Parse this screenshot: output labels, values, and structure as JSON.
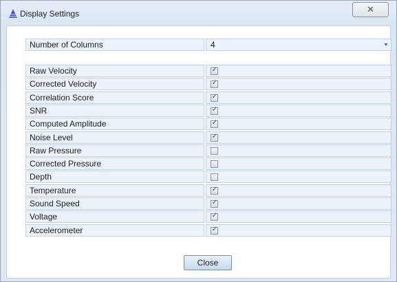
{
  "window": {
    "title": "Display Settings",
    "close_glyph": "✕"
  },
  "number_of_columns": {
    "label": "Number of Columns",
    "value": "4"
  },
  "options": [
    {
      "label": "Raw Velocity",
      "checked": true
    },
    {
      "label": "Corrected Velocity",
      "checked": true
    },
    {
      "label": "Correlation Score",
      "checked": true
    },
    {
      "label": "SNR",
      "checked": true
    },
    {
      "label": "Computed Amplitude",
      "checked": true
    },
    {
      "label": "Noise Level",
      "checked": true
    },
    {
      "label": "Raw Pressure",
      "checked": false
    },
    {
      "label": "Corrected Pressure",
      "checked": false
    },
    {
      "label": "Depth",
      "checked": false
    },
    {
      "label": "Temperature",
      "checked": true
    },
    {
      "label": "Sound Speed",
      "checked": true
    },
    {
      "label": "Voltage",
      "checked": true
    },
    {
      "label": "Accelerometer",
      "checked": true
    }
  ],
  "close_button": {
    "label": "Close"
  },
  "icons": {
    "app": "app-triangle-icon",
    "close": "close-icon",
    "dropdown": "chevron-down-icon",
    "check": "check-icon"
  },
  "colors": {
    "row_background": "#ebf2fa",
    "row_border": "#c3d2e3",
    "accent": "#4a7fb8"
  }
}
